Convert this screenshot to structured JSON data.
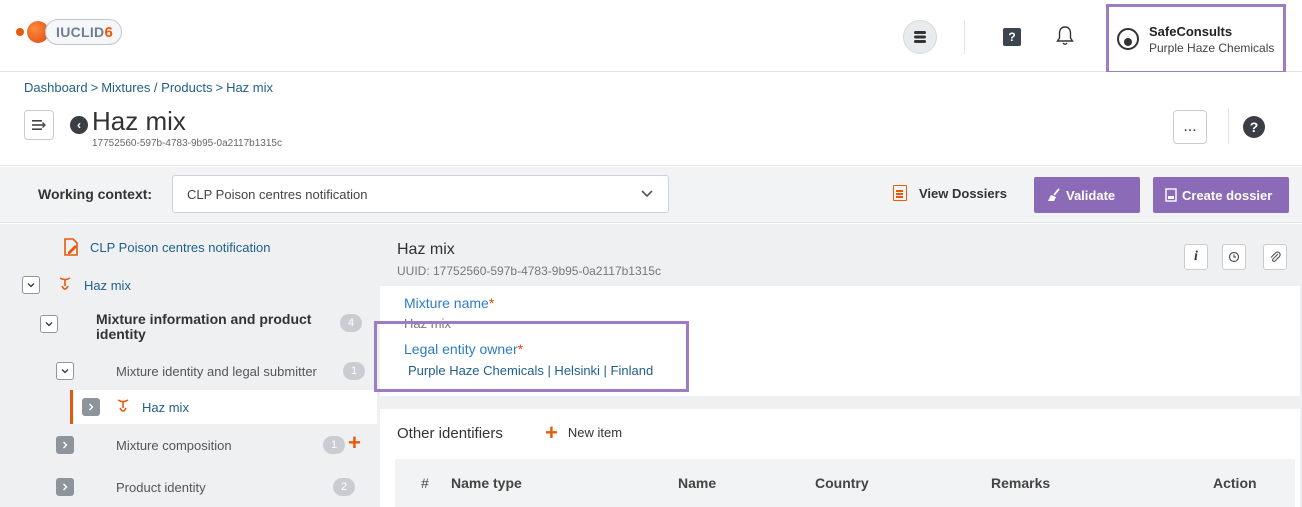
{
  "app": {
    "logo_text": "IUCLID",
    "logo_version": "6"
  },
  "user": {
    "name": "SafeConsults",
    "organisation": "Purple Haze Chemicals"
  },
  "breadcrumb": {
    "items": [
      "Dashboard",
      "Mixtures / Products",
      "Haz mix"
    ],
    "separator": ">"
  },
  "header": {
    "title": "Haz mix",
    "uuid": "17752560-597b-4783-9b95-0a2117b1315c",
    "more_label": "...",
    "help_label": "?"
  },
  "context": {
    "label": "Working context:",
    "selected": "CLP Poison centres notification",
    "view_dossiers": "View Dossiers",
    "validate": "Validate",
    "create_dossier": "Create dossier"
  },
  "tree": {
    "root": "CLP Poison centres notification",
    "item_hazmix": "Haz mix",
    "section1": "Mixture information and product identity",
    "section1_count": "4",
    "sub1": "Mixture identity and legal submitter",
    "sub1_count": "1",
    "leaf": "Haz mix",
    "sub2": "Mixture composition",
    "sub2_count": "1",
    "sub3": "Product identity",
    "sub3_count": "2"
  },
  "detail": {
    "title": "Haz mix",
    "uuid": "UUID: 17752560-597b-4783-9b95-0a2117b1315c",
    "info_label": "i",
    "mixture_name_label": "Mixture name",
    "required_mark": "*",
    "mixture_name_value": "Haz mix",
    "legal_entity_label": "Legal entity owner",
    "legal_entity_value": "Purple Haze Chemicals | Helsinki | Finland"
  },
  "other_identifiers": {
    "title": "Other identifiers",
    "new_item": "New item",
    "columns": [
      "#",
      "Name type",
      "Name",
      "Country",
      "Remarks",
      "Action"
    ]
  },
  "colors": {
    "accent_purple": "#8b6bb8",
    "highlight_border": "#9c7dc2",
    "accent_orange": "#e8590c",
    "link_blue": "#2d7bc4"
  }
}
